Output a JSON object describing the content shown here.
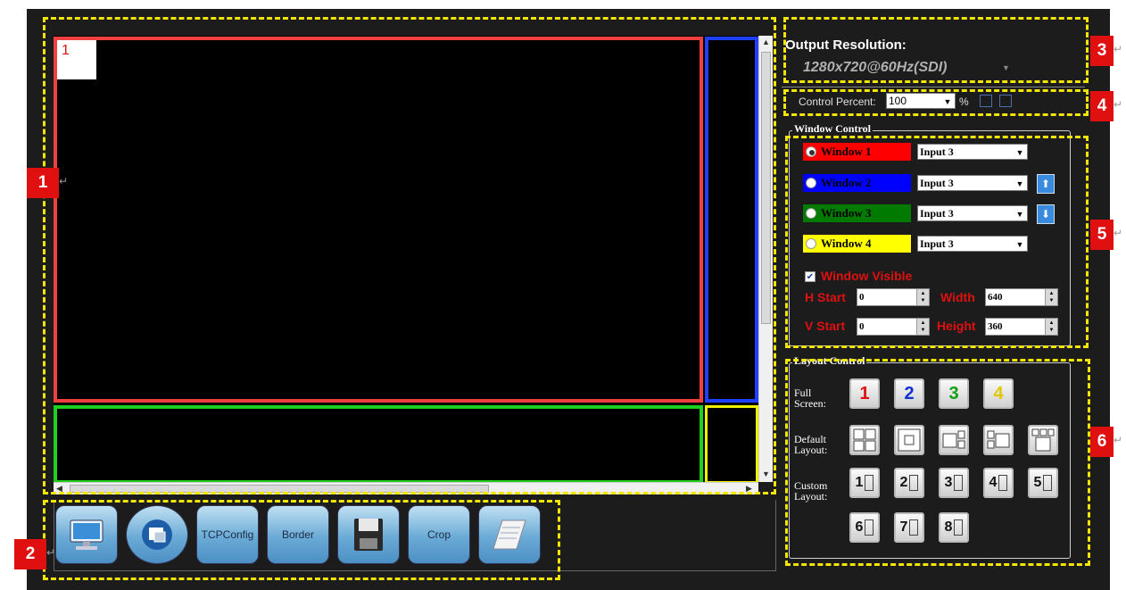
{
  "callouts": [
    "1",
    "2",
    "3",
    "4",
    "5",
    "6"
  ],
  "callout_suffix": "↵",
  "canvas": {
    "window1_number": "1"
  },
  "toolbar": {
    "buttons": [
      {
        "label": "",
        "icon": "monitor-icon"
      },
      {
        "label": "",
        "icon": "window-icon"
      },
      {
        "label": "TCPConfig",
        "icon": ""
      },
      {
        "label": "Border",
        "icon": ""
      },
      {
        "label": "",
        "icon": "save-icon"
      },
      {
        "label": "Crop",
        "icon": ""
      },
      {
        "label": "",
        "icon": "notepad-icon"
      }
    ]
  },
  "output": {
    "title": "Output Resolution:",
    "value": "1280x720@60Hz(SDI)"
  },
  "control_percent": {
    "label": "Control Percent:",
    "value": "100",
    "unit": "%"
  },
  "window_control": {
    "title": "Window Control",
    "windows": [
      {
        "label": "Window 1",
        "input": "Input 3",
        "selected": true,
        "color": "#ff0000",
        "text_color": "#000000"
      },
      {
        "label": "Window 2",
        "input": "Input 3",
        "selected": false,
        "color": "#0000ff",
        "text_color": "#000000"
      },
      {
        "label": "Window 3",
        "input": "Input 3",
        "selected": false,
        "color": "#007a00",
        "text_color": "#000000"
      },
      {
        "label": "Window 4",
        "input": "Input 3",
        "selected": false,
        "color": "#ffff00",
        "text_color": "#000000"
      }
    ],
    "visible_label": "Window Visible",
    "h_start_label": "H Start",
    "h_start": "0",
    "v_start_label": "V Start",
    "v_start": "0",
    "width_label": "Width",
    "width": "640",
    "height_label": "Height",
    "height": "360"
  },
  "layout_control": {
    "title": "Layout Control",
    "full_screen_label": "Full Screen:",
    "default_layout_label": "Default Layout:",
    "custom_layout_label": "Custom Layout:",
    "full_screen": [
      {
        "label": "1",
        "color": "#e01010"
      },
      {
        "label": "2",
        "color": "#1030d0"
      },
      {
        "label": "3",
        "color": "#10a010"
      },
      {
        "label": "4",
        "color": "#e0c800"
      }
    ],
    "custom": [
      "1",
      "2",
      "3",
      "4",
      "5",
      "6",
      "7",
      "8"
    ]
  },
  "colors": {
    "accent": "#f2e600",
    "callout": "#e01010"
  }
}
